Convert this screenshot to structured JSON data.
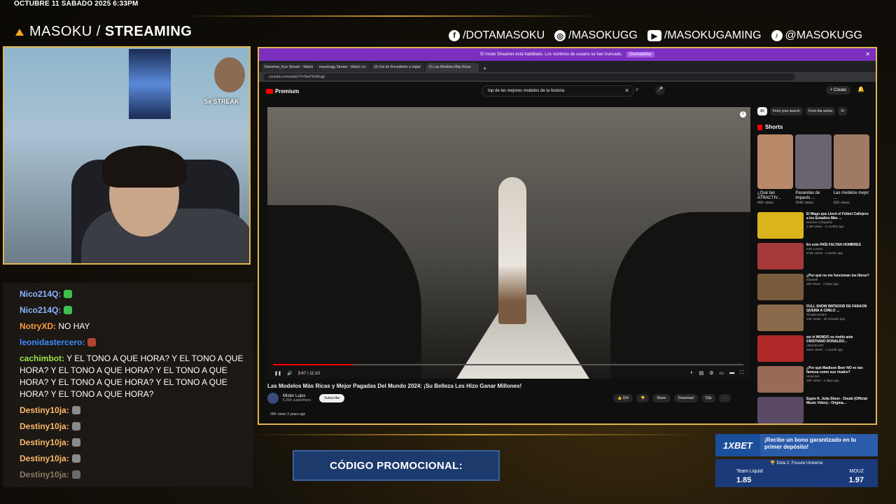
{
  "overlay": {
    "datetime": "OCTUBRE 11 SABADO 2025 6:33PM",
    "brand_light": "MASOKU / ",
    "brand_bold": "STREAMING",
    "socials": [
      {
        "icon": "facebook-icon",
        "glyph": "f",
        "label": "/DOTAMASOKU"
      },
      {
        "icon": "instagram-icon",
        "glyph": "◎",
        "label": "/MASOKUGG"
      },
      {
        "icon": "youtube-icon",
        "glyph": "▶",
        "label": "/MASOKUGAMING"
      },
      {
        "icon": "tiktok-icon",
        "glyph": "♪",
        "label": "@MASOKUGG"
      }
    ],
    "streak": "5x STREAK",
    "promo": "CÓDIGO PROMOCIONAL:",
    "accent": "#e0b64c"
  },
  "chat": [
    {
      "user": "Nico214Q:",
      "text": "",
      "color": "#8ab4ff",
      "emote": "#3fbf4f"
    },
    {
      "user": "Nico214Q:",
      "text": "",
      "color": "#8ab4ff",
      "emote": "#3fbf4f"
    },
    {
      "user": "NotryXD:",
      "text": "NO HAY",
      "color": "#ff9a3c",
      "emote": ""
    },
    {
      "user": "leonidastercero:",
      "text": "",
      "color": "#3c8cff",
      "emote": "#b0452e"
    },
    {
      "user": "cachimbot:",
      "text": "Y EL TONO A QUE HORA? Y EL TONO A QUE HORA? Y EL TONO A QUE HORA? Y EL TONO A QUE HORA? Y EL TONO A QUE HORA? Y EL TONO A QUE HORA? Y EL TONO A QUE HORA?",
      "color": "#9be04c",
      "emote": ""
    },
    {
      "user": "Destiny10ja:",
      "text": "",
      "color": "#ffb86b",
      "emote": "#8a8a8a"
    },
    {
      "user": "Destiny10ja:",
      "text": "",
      "color": "#ffb86b",
      "emote": "#8a8a8a"
    },
    {
      "user": "Destiny10ja:",
      "text": "",
      "color": "#ffb86b",
      "emote": "#8a8a8a"
    },
    {
      "user": "Destiny10ja:",
      "text": "",
      "color": "#ffb86b",
      "emote": "#8a8a8a"
    },
    {
      "user": "Destiny10ja:",
      "text": "",
      "color": "#8c7a66",
      "emote": "#6a6a6a"
    }
  ],
  "browser": {
    "notice": "El modo Streamer está habilitado. Los nombres de usuario se han truncado.",
    "notice_btn": "Deshabilitar",
    "tabs": [
      {
        "label": "Ramshes_Kurr Stream - Watch",
        "active": false
      },
      {
        "label": "masokugg Stream - Watch Liv",
        "active": false
      },
      {
        "label": "(3) Gol de Ronaldinho a Inglat",
        "active": false
      },
      {
        "label": "(3) Las Modelos Más Ricas",
        "active": true
      }
    ],
    "url": "youtube.com/watch?v=9wl7lmNkqgI"
  },
  "youtube": {
    "logo": "Premium",
    "search_value": "top de las mejores modelos de la historia",
    "create": "+ Create",
    "progress": 0.17,
    "time": "3:47 / 11:10",
    "title": "Las Modelos Más Ricas y Mejor Pagadas Del Mundo 2024: ¡Su Belleza Les Hizo Ganar Millones!",
    "channel": "Mister Lujos",
    "subs": "5.26K subscribers",
    "subscribe": "Subscribe",
    "likes": "👍 324",
    "share": "Share",
    "download": "Download",
    "clip": "Clip",
    "views": "26K views  3 years ago",
    "chips": [
      "All",
      "From your search",
      "From the series",
      "Fr"
    ],
    "shorts_heading": "Shorts",
    "shorts": [
      {
        "title": "¿Qué tan ATRACTIV...",
        "views": "46K views",
        "color": "#b88a6a"
      },
      {
        "title": "Pasarelas de impacto ...",
        "views": "254K views",
        "color": "#6a6470"
      },
      {
        "title": "Las modelos mejor ...",
        "views": "92K views",
        "color": "#a07a62"
      }
    ],
    "recs": [
      {
        "title": "El Mago que Llevó el Fútbol Callejero a los Estadios Más ...",
        "channel": "Número 9 Español",
        "meta": "1.3M views · 3 months ago",
        "color": "#d9b41c"
      },
      {
        "title": "En este PAÍS FALTAN HOMBRES",
        "channel": "Inés Lorsen",
        "meta": "674K views · 2 weeks ago",
        "color": "#a63a3a"
      },
      {
        "title": "¿Por qué no me funcionan los libros?",
        "channel": "Elsaheft",
        "meta": "250 views · 2 days ago",
        "color": "#7a5b3e"
      },
      {
        "title": "FULL SHOW IMITADOR DE FARAON QUEMA A CIRILO ...",
        "channel": "Risatila Enters",
        "meta": "14K views · 36 minutes ago",
        "color": "#8a6a4a"
      },
      {
        "title": "así el MUNDO se rindió ante CRISTIANO RONALDO...",
        "channel": "HENOKART",
        "meta": "451K views · 1 month ago",
        "color": "#b02828"
      },
      {
        "title": "¿Por qué Madison Beer NO es tan famosa como sus rivales?",
        "channel": "Historinia",
        "meta": "18K views · 2 days ago",
        "color": "#9a6a58"
      },
      {
        "title": "Eppio ft. Julia Sheer - Doubt (Official Music Video) - Origina...",
        "channel": "",
        "meta": "",
        "color": "#5a4a66"
      }
    ]
  },
  "bet": {
    "brand": "1XBET",
    "bonus": "¡Recibe un bono garantizado en tu primer depósito!",
    "game": "🏆 Dota 2. Fissure Universe",
    "team1": "Team Liquid",
    "odds1": "1.85",
    "team2": "MOUZ",
    "odds2": "1.97"
  }
}
